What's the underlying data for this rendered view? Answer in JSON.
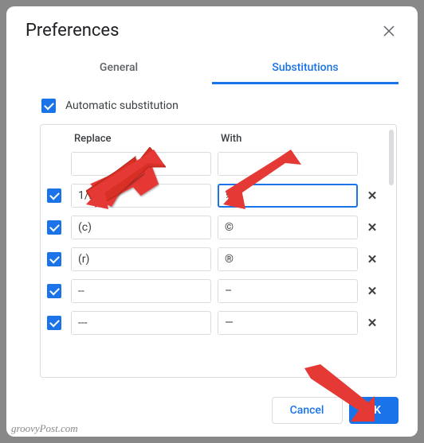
{
  "dialog": {
    "title": "Preferences",
    "tabs": {
      "general": "General",
      "substitutions": "Substitutions"
    },
    "auto_substitution_label": "Automatic substitution",
    "auto_substitution_checked": true
  },
  "table": {
    "headers": {
      "replace": "Replace",
      "with": "With"
    },
    "rows": [
      {
        "enabled": null,
        "replace": "",
        "with": "",
        "deletable": false
      },
      {
        "enabled": true,
        "replace": "1/2",
        "with": "½",
        "deletable": true,
        "focused": "with"
      },
      {
        "enabled": true,
        "replace": "(c)",
        "with": "©",
        "deletable": true
      },
      {
        "enabled": true,
        "replace": "(r)",
        "with": "®",
        "deletable": true
      },
      {
        "enabled": true,
        "replace": "--",
        "with": "–",
        "deletable": true
      },
      {
        "enabled": true,
        "replace": "---",
        "with": "—",
        "deletable": true
      }
    ]
  },
  "footer": {
    "cancel": "Cancel",
    "ok": "OK"
  },
  "watermark": "groovyPost.com"
}
